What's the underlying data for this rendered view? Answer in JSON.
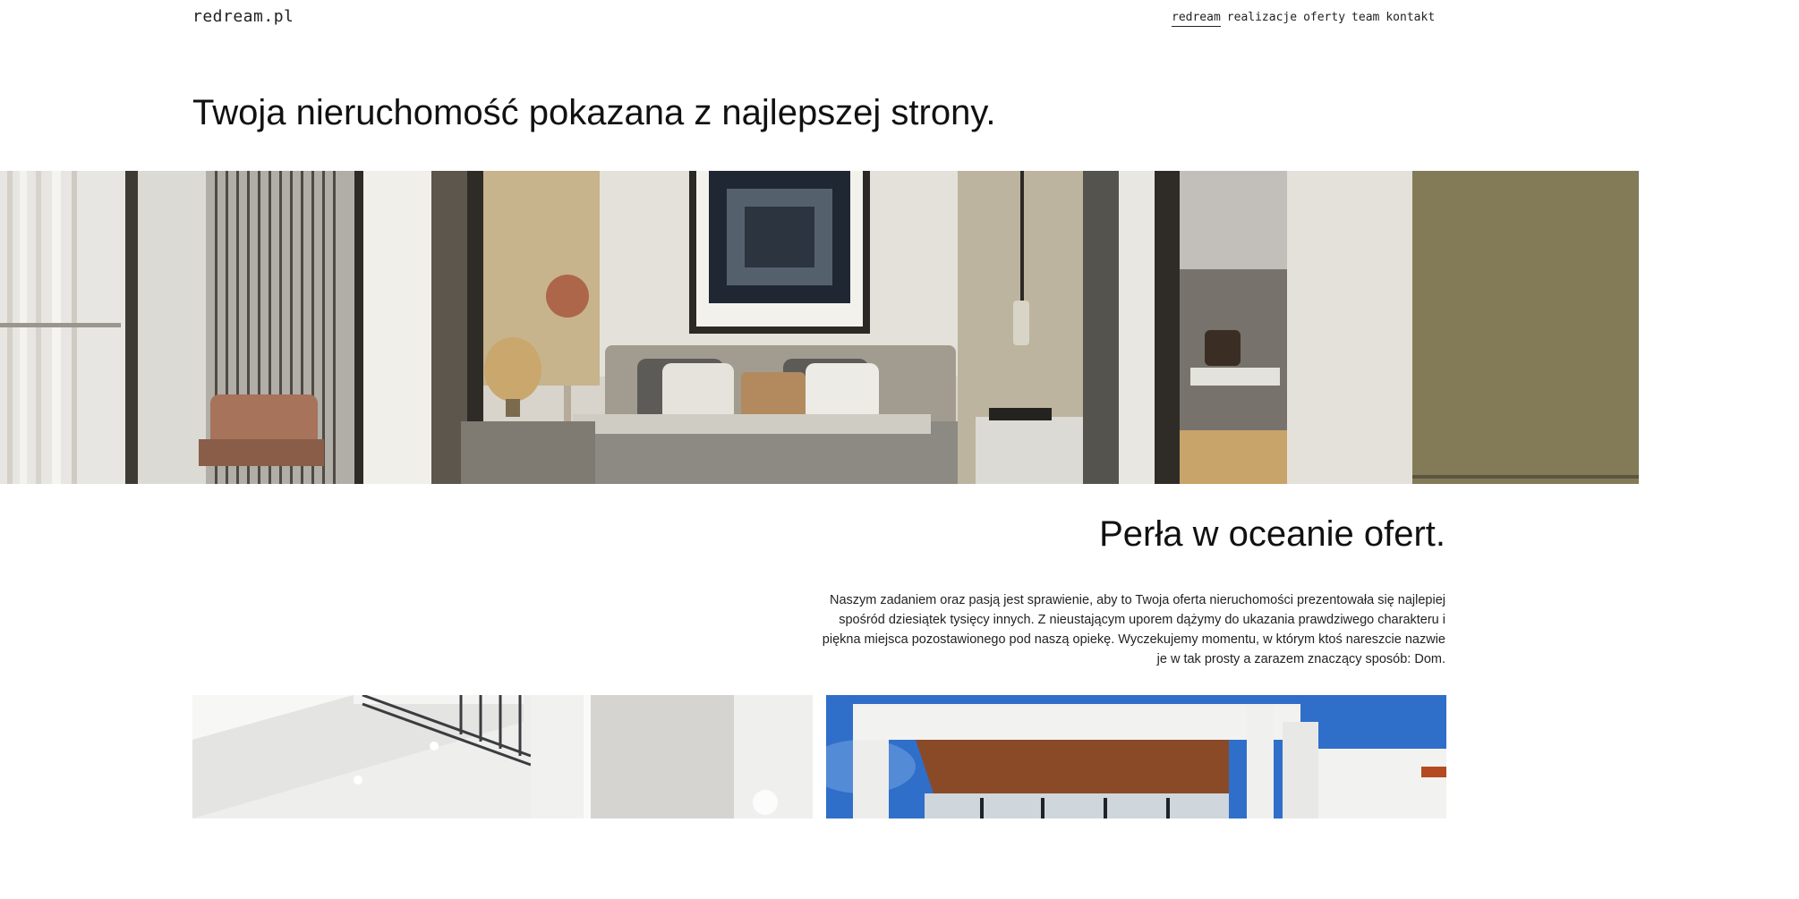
{
  "header": {
    "logo": "redream.pl",
    "nav": [
      {
        "label": "redream",
        "active": true
      },
      {
        "label": "realizacje",
        "active": false
      },
      {
        "label": "oferty",
        "active": false
      },
      {
        "label": "team",
        "active": false
      },
      {
        "label": "kontakt",
        "active": false
      }
    ]
  },
  "hero": {
    "title": "Twoja nieruchomość pokazana z najlepszej strony."
  },
  "section": {
    "title": "Perła w oceanie ofert.",
    "text": "Naszym zadaniem oraz pasją jest sprawienie, aby to Twoja oferta nieruchomości prezentowała się najlepiej spośród dziesiątek tysięcy innych. Z nieustającym uporem dążymy do ukazania prawdziwego charakteru i piękna miejsca pozostawionego pod naszą opiekę. Wyczekujemy momentu, w którym ktoś nareszcie nazwie je w tak prosty a zarazem znaczący sposób: Dom."
  },
  "colors": {
    "text": "#111111",
    "background": "#ffffff",
    "sky": "#2f6fc9",
    "wood": "#8a4a28"
  }
}
